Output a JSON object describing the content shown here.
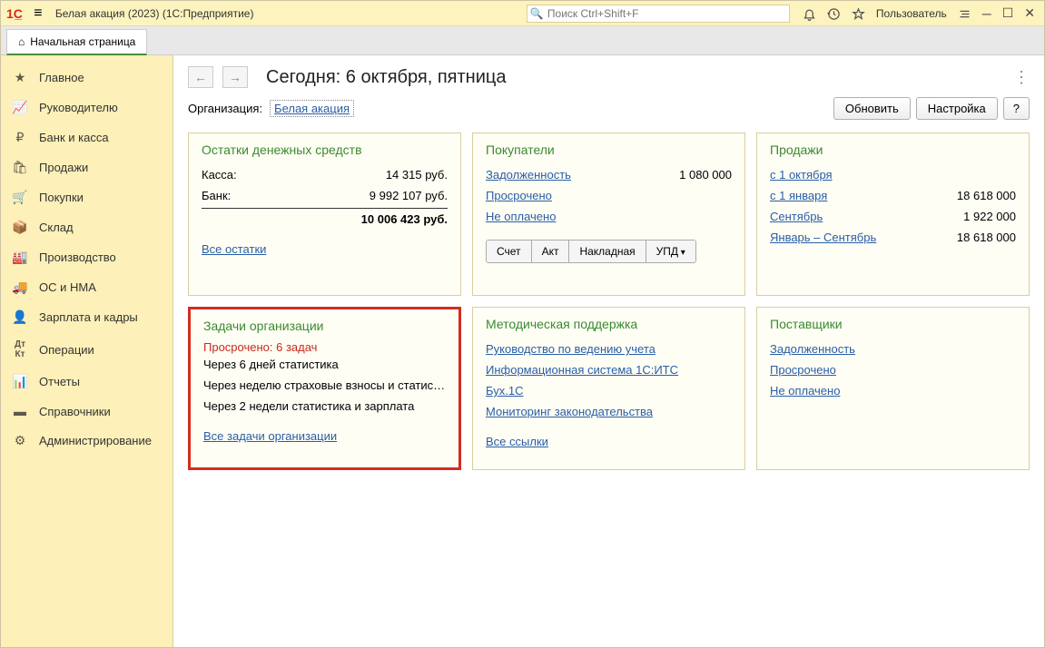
{
  "titlebar": {
    "app_title": "Белая акация (2023)  (1С:Предприятие)",
    "search_placeholder": "Поиск Ctrl+Shift+F",
    "user": "Пользователь"
  },
  "tab": {
    "label": "Начальная страница"
  },
  "sidebar": {
    "items": [
      {
        "label": "Главное"
      },
      {
        "label": "Руководителю"
      },
      {
        "label": "Банк и касса"
      },
      {
        "label": "Продажи"
      },
      {
        "label": "Покупки"
      },
      {
        "label": "Склад"
      },
      {
        "label": "Производство"
      },
      {
        "label": "ОС и НМА"
      },
      {
        "label": "Зарплата и кадры"
      },
      {
        "label": "Операции"
      },
      {
        "label": "Отчеты"
      },
      {
        "label": "Справочники"
      },
      {
        "label": "Администрирование"
      }
    ]
  },
  "header": {
    "title": "Сегодня: 6 октября, пятница",
    "org_label": "Организация:",
    "org_value": "Белая акация",
    "btn_refresh": "Обновить",
    "btn_settings": "Настройка",
    "btn_help": "?"
  },
  "cash": {
    "title": "Остатки денежных средств",
    "rows": [
      {
        "label": "Касса:",
        "value": "14 315 руб."
      },
      {
        "label": "Банк:",
        "value": "9 992 107 руб."
      }
    ],
    "total": "10 006 423 руб.",
    "all_link": "Все остатки"
  },
  "buyers": {
    "title": "Покупатели",
    "rows": [
      {
        "label": "Задолженность",
        "value": "1 080 000"
      },
      {
        "label": "Просрочено",
        "value": ""
      },
      {
        "label": "Не оплачено",
        "value": ""
      }
    ],
    "doc_btns": [
      "Счет",
      "Акт",
      "Накладная",
      "УПД"
    ]
  },
  "sales": {
    "title": "Продажи",
    "rows": [
      {
        "label": "с 1 октября",
        "value": ""
      },
      {
        "label": "с 1 января",
        "value": "18 618 000"
      },
      {
        "label": "Сентябрь",
        "value": "1 922 000"
      },
      {
        "label": "Январь – Сентябрь",
        "value": "18 618 000"
      }
    ]
  },
  "tasks": {
    "title": "Задачи организации",
    "overdue": "Просрочено: 6 задач",
    "items": [
      "Через 6 дней статистика",
      "Через неделю страховые взносы и статис…",
      "Через 2 недели статистика и зарплата"
    ],
    "all_link": "Все задачи организации"
  },
  "support": {
    "title": "Методическая поддержка",
    "links": [
      "Руководство по ведению учета",
      "Информационная система 1С:ИТС",
      "Бух.1С",
      "Мониторинг законодательства"
    ],
    "all_link": "Все ссылки"
  },
  "suppliers": {
    "title": "Поставщики",
    "links": [
      "Задолженность",
      "Просрочено",
      "Не оплачено"
    ]
  }
}
